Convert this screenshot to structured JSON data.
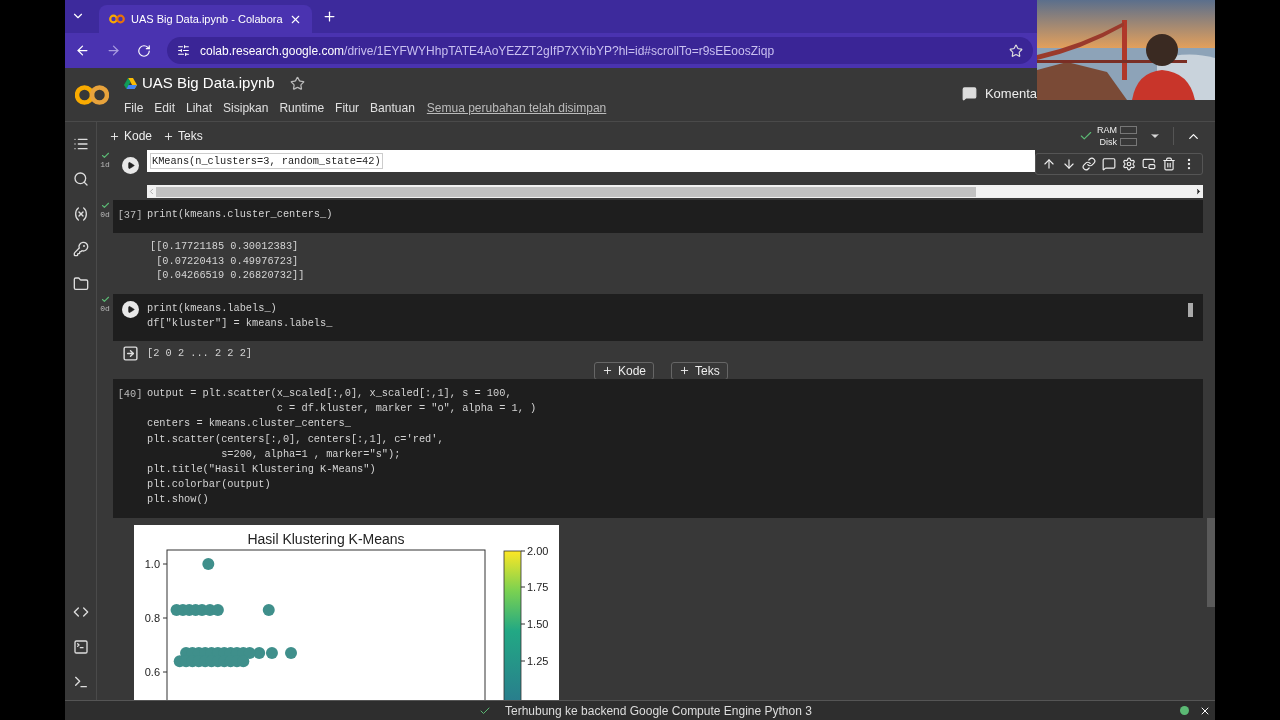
{
  "browser": {
    "tab_title": "UAS Big Data.ipynb - Colabora",
    "url_host": "colab.research.google.com",
    "url_path": "/drive/1EYFWYHhpTATE4AoYEZZT2gIfP7XYibYP?hl=id#scrollTo=r9sEEoosZiqp"
  },
  "header": {
    "title": "UAS Big Data.ipynb",
    "menu": [
      "File",
      "Edit",
      "Lihat",
      "Sisipkan",
      "Runtime",
      "Fitur",
      "Bantuan"
    ],
    "save_status": "Semua perubahan telah disimpan",
    "comment_label": "Komenta"
  },
  "toolbar": {
    "add_buttons": [
      "Kode",
      "Teks"
    ],
    "resources": [
      "RAM",
      "Disk"
    ],
    "connected": true
  },
  "cells": [
    {
      "selected": true,
      "status": "1d",
      "code": [
        "KMeans(n_clusters=3, random_state=42)"
      ]
    },
    {
      "selected": false,
      "status": "0d",
      "prompt": "[37]",
      "code": [
        "print(kmeans.cluster_centers_)"
      ],
      "output": {
        "kind": "text",
        "lines": [
          "[[0.17721185 0.30012383]",
          " [0.07220413 0.49976723]",
          " [0.04266519 0.26820732]]"
        ]
      }
    },
    {
      "selected": false,
      "status": "0d",
      "code": [
        "print(kmeans.labels_)",
        "df[\"kluster\"] = kmeans.labels_"
      ],
      "output": {
        "kind": "stream",
        "lines": [
          "[2 0 2 ... 2 2 2]"
        ]
      }
    },
    {
      "selected": false,
      "prompt": "[40]",
      "code": [
        "output = plt.scatter(x_scaled[:,0], x_scaled[:,1], s = 100,",
        "                     c = df.kluster, marker = \"o\", alpha = 1, )",
        "centers = kmeans.cluster_centers_",
        "plt.scatter(centers[:,0], centers[:,1], c='red',",
        "            s=200, alpha=1 , marker=\"s\");",
        "plt.title(\"Hasil Klustering K-Means\")",
        "plt.colorbar(output)",
        "plt.show()"
      ],
      "output": {
        "kind": "plot",
        "title": "Hasil Klustering K-Means",
        "y_tick_labels": [
          "1.0",
          "0.8",
          "0.6"
        ],
        "colorbar_ticks": [
          "2.00",
          "1.75",
          "1.50",
          "1.25"
        ]
      }
    }
  ],
  "add_cell_buttons": [
    "Kode",
    "Teks"
  ],
  "status_bar": {
    "text": "Terhubung ke backend Google Compute Engine Python 3"
  },
  "webcam": {
    "kind": "picture"
  }
}
